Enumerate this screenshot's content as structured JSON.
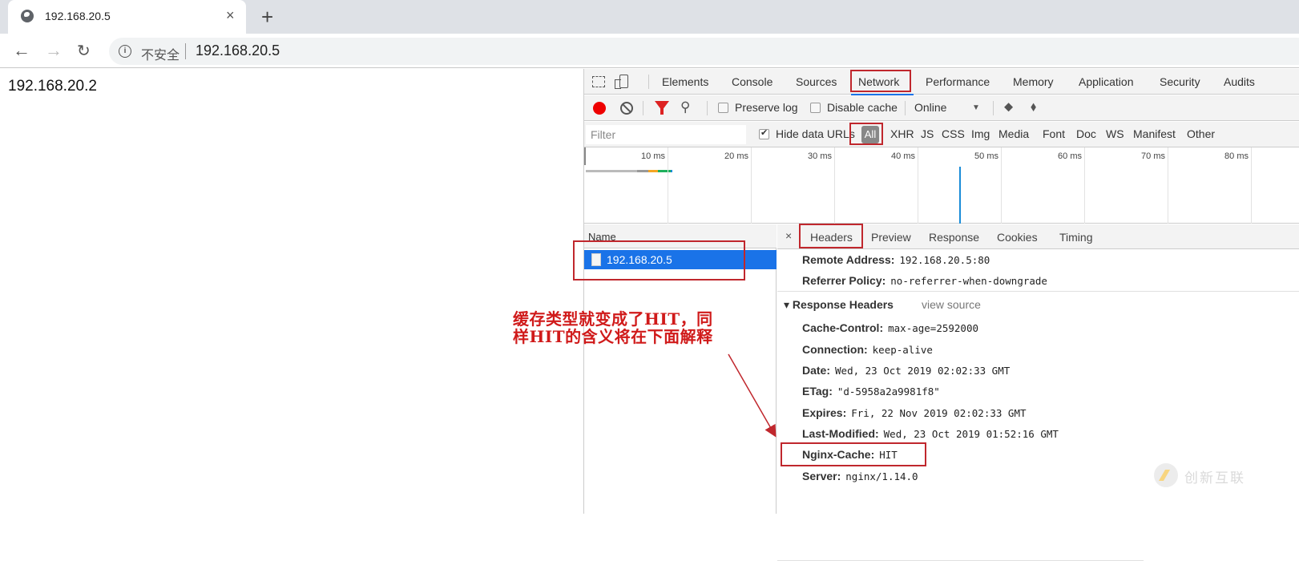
{
  "browser": {
    "tab_title": "192.168.20.5",
    "tab_close": "×",
    "new_tab": "+",
    "back": "←",
    "forward": "→",
    "reload": "↻",
    "security_label": "不安全",
    "url": "192.168.20.5",
    "info_icon": "i"
  },
  "page": {
    "text": "192.168.20.2"
  },
  "devtools": {
    "tabs": [
      "Elements",
      "Console",
      "Sources",
      "Network",
      "Performance",
      "Memory",
      "Application",
      "Security",
      "Audits"
    ],
    "active_tab": "Network",
    "controls": {
      "preserve_log": {
        "label": "Preserve log",
        "checked": false
      },
      "disable_cache": {
        "label": "Disable cache",
        "checked": false
      },
      "throttle": "Online",
      "throttle_arrow": "▼",
      "search_icon": "🔍",
      "upload_icon": "🡅",
      "download_icon": "🡇"
    },
    "filter": {
      "placeholder": "Filter",
      "hide_data_urls": {
        "label": "Hide data URLs",
        "checked": true
      },
      "types": [
        "All",
        "XHR",
        "JS",
        "CSS",
        "Img",
        "Media",
        "Font",
        "Doc",
        "WS",
        "Manifest",
        "Other"
      ],
      "active_type": "All"
    },
    "overview": {
      "ticks": [
        "10 ms",
        "20 ms",
        "30 ms",
        "40 ms",
        "50 ms",
        "60 ms",
        "70 ms",
        "80 ms"
      ],
      "load_event_ms": 45
    },
    "request_list": {
      "column": "Name",
      "requests": [
        {
          "name": "192.168.20.5",
          "selected": true
        }
      ]
    },
    "details": {
      "close": "×",
      "tabs": [
        "Headers",
        "Preview",
        "Response",
        "Cookies",
        "Timing"
      ],
      "active_tab": "Headers",
      "general": [
        {
          "key": "Remote Address:",
          "value": "192.168.20.5:80"
        },
        {
          "key": "Referrer Policy:",
          "value": "no-referrer-when-downgrade"
        }
      ],
      "response_headers_title": "▾ Response Headers",
      "view_source": "view source",
      "response_headers": [
        {
          "key": "Cache-Control:",
          "value": "max-age=2592000"
        },
        {
          "key": "Connection:",
          "value": "keep-alive"
        },
        {
          "key": "Date:",
          "value": "Wed, 23 Oct 2019 02:02:33 GMT"
        },
        {
          "key": "ETag:",
          "value": "\"d-5958a2a9981f8\""
        },
        {
          "key": "Expires:",
          "value": "Fri, 22 Nov 2019 02:02:33 GMT"
        },
        {
          "key": "Last-Modified:",
          "value": "Wed, 23 Oct 2019 01:52:16 GMT"
        },
        {
          "key": "Nginx-Cache:",
          "value": "HIT"
        },
        {
          "key": "Server:",
          "value": "nginx/1.14.0"
        }
      ]
    }
  },
  "annotation": {
    "text": "缓存类型就变成了HIT，同\n样HIT的含义将在下面解释",
    "color": "#d01a1a"
  },
  "watermark": {
    "text": "创新互联"
  }
}
